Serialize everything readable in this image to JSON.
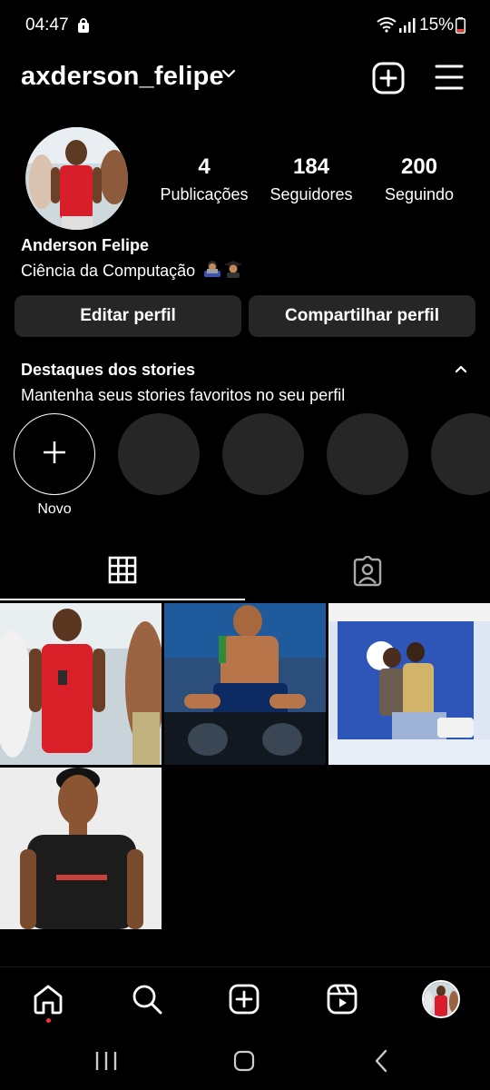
{
  "status_bar": {
    "time": "04:47",
    "battery": "15%",
    "icons": [
      "lock-icon",
      "wifi-icon",
      "signal-icon",
      "battery-icon"
    ]
  },
  "header": {
    "username": "axderson_felipe",
    "icons": [
      "chevron-down-icon",
      "add-post-icon",
      "menu-icon"
    ]
  },
  "profile": {
    "stats": [
      {
        "value": "4",
        "label": "Publicações"
      },
      {
        "value": "184",
        "label": "Seguidores"
      },
      {
        "value": "200",
        "label": "Seguindo"
      }
    ],
    "full_name": "Anderson Felipe",
    "bio": "Ciência da Computação",
    "bio_emojis": [
      "technologist-emoji",
      "graduate-emoji"
    ]
  },
  "buttons": {
    "edit": "Editar perfil",
    "share": "Compartilhar perfil"
  },
  "highlights": {
    "title": "Destaques dos stories",
    "subtitle": "Mantenha seus stories favoritos no seu perfil",
    "new_label": "Novo"
  },
  "tabs": [
    "grid-icon",
    "tagged-icon"
  ],
  "posts": [
    "post-photo-1",
    "post-photo-2",
    "post-photo-3",
    "post-photo-4"
  ],
  "bottom_nav": [
    "home-icon",
    "search-icon",
    "create-icon",
    "reels-icon",
    "profile-avatar"
  ],
  "system_nav": [
    "recents-icon",
    "home-button-icon",
    "back-icon"
  ],
  "colors": {
    "background": "#000000",
    "button_bg": "#262626",
    "notification_dot": "#ff3040"
  }
}
